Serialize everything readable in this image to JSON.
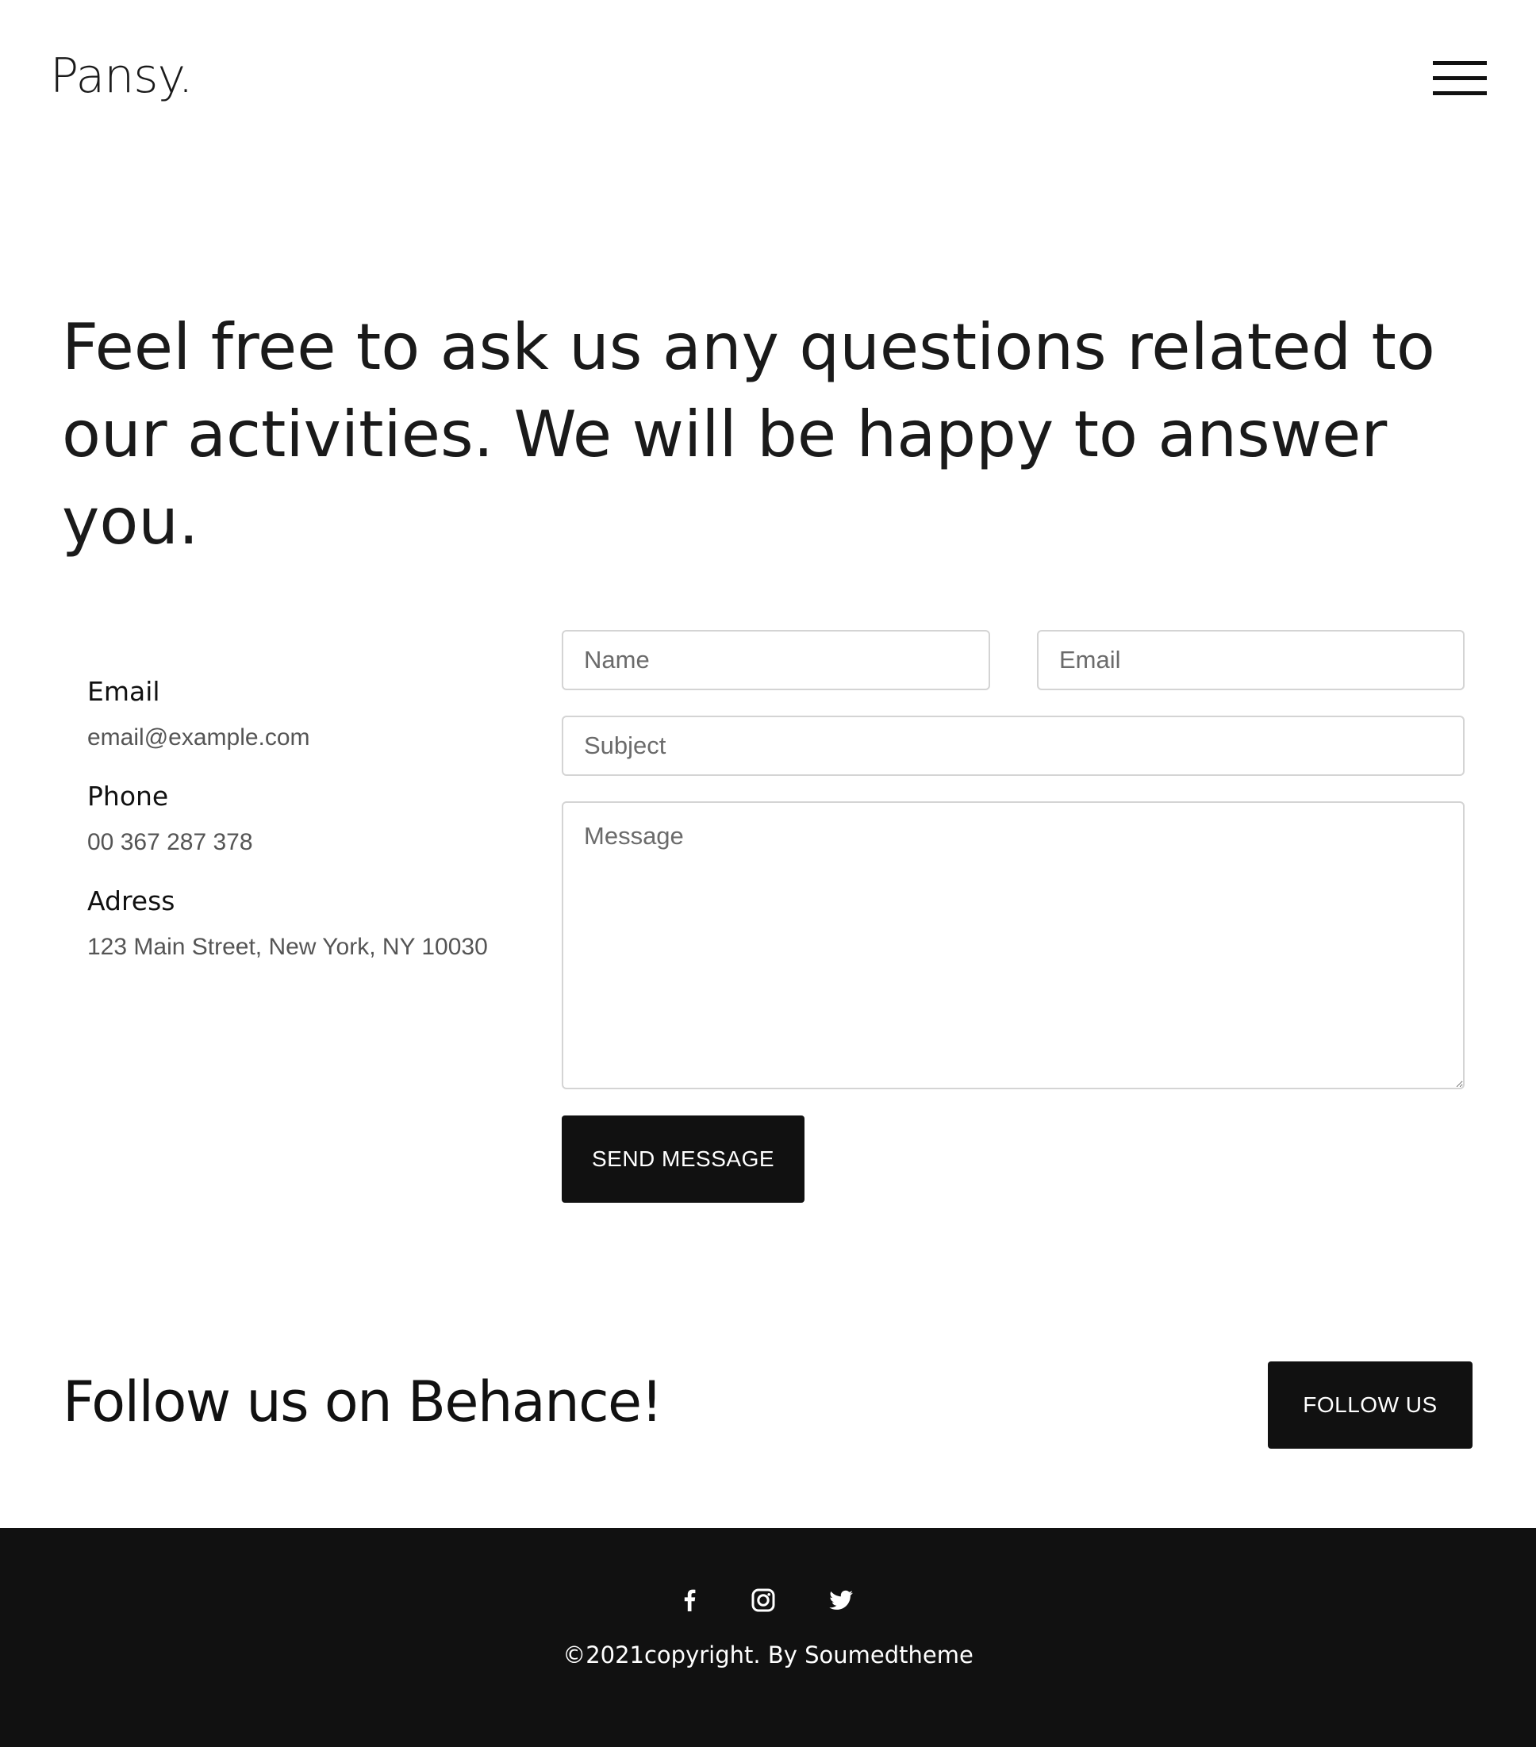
{
  "header": {
    "logo": "Pansy.",
    "menu_icon": "hamburger-menu-icon"
  },
  "hero": {
    "heading": "Feel free to ask us any questions related to our activities. We will be happy to answer you."
  },
  "contact_info": {
    "email_label": "Email",
    "email_value": "email@example.com",
    "phone_label": "Phone",
    "phone_value": "00 367 287 378",
    "address_label": "Adress",
    "address_value": "123 Main Street, New York, NY 10030"
  },
  "form": {
    "name_placeholder": "Name",
    "email_placeholder": "Email",
    "subject_placeholder": "Subject",
    "message_placeholder": "Message",
    "name_value": "",
    "email_value": "",
    "subject_value": "",
    "message_value": "",
    "submit_label": "SEND MESSAGE"
  },
  "follow": {
    "heading": "Follow us on Behance!",
    "button_label": "FOLLOW US"
  },
  "footer": {
    "social_icons": [
      "facebook-icon",
      "instagram-icon",
      "twitter-icon"
    ],
    "copyright": "©2021copyright. By Soumedtheme"
  },
  "colors": {
    "text": "#111111",
    "muted_text": "#555555",
    "button_bg": "#111111",
    "button_text": "#ffffff",
    "footer_bg": "#111111",
    "input_border": "#d4d4d4"
  }
}
